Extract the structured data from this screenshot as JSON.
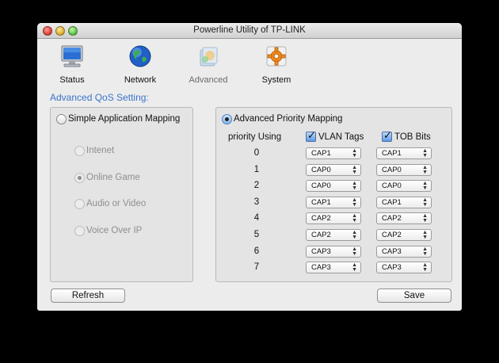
{
  "window": {
    "title": "Powerline Utility of TP-LINK"
  },
  "toolbar": {
    "items": [
      {
        "label": "Status",
        "icon": "monitor-icon"
      },
      {
        "label": "Network",
        "icon": "globe-icon"
      },
      {
        "label": "Advanced",
        "icon": "advanced-icon"
      },
      {
        "label": "System",
        "icon": "gear-icon"
      }
    ]
  },
  "section_title": "Advanced QoS Setting:",
  "simple": {
    "label": "Simple Application Mapping",
    "options": [
      "Intenet",
      "Online Game",
      "Audio or Video",
      "Voice Over IP"
    ],
    "selected": "Online Game"
  },
  "advanced": {
    "label": "Advanced Priority Mapping",
    "priority_header": "priority Using",
    "vlan_label": "VLAN Tags",
    "tob_label": "TOB Bits",
    "rows": [
      {
        "priority": "0",
        "vlan": "CAP1",
        "tob": "CAP1"
      },
      {
        "priority": "1",
        "vlan": "CAP0",
        "tob": "CAP0"
      },
      {
        "priority": "2",
        "vlan": "CAP0",
        "tob": "CAP0"
      },
      {
        "priority": "3",
        "vlan": "CAP1",
        "tob": "CAP1"
      },
      {
        "priority": "4",
        "vlan": "CAP2",
        "tob": "CAP2"
      },
      {
        "priority": "5",
        "vlan": "CAP2",
        "tob": "CAP2"
      },
      {
        "priority": "6",
        "vlan": "CAP3",
        "tob": "CAP3"
      },
      {
        "priority": "7",
        "vlan": "CAP3",
        "tob": "CAP3"
      }
    ]
  },
  "buttons": {
    "refresh": "Refresh",
    "save": "Save"
  }
}
